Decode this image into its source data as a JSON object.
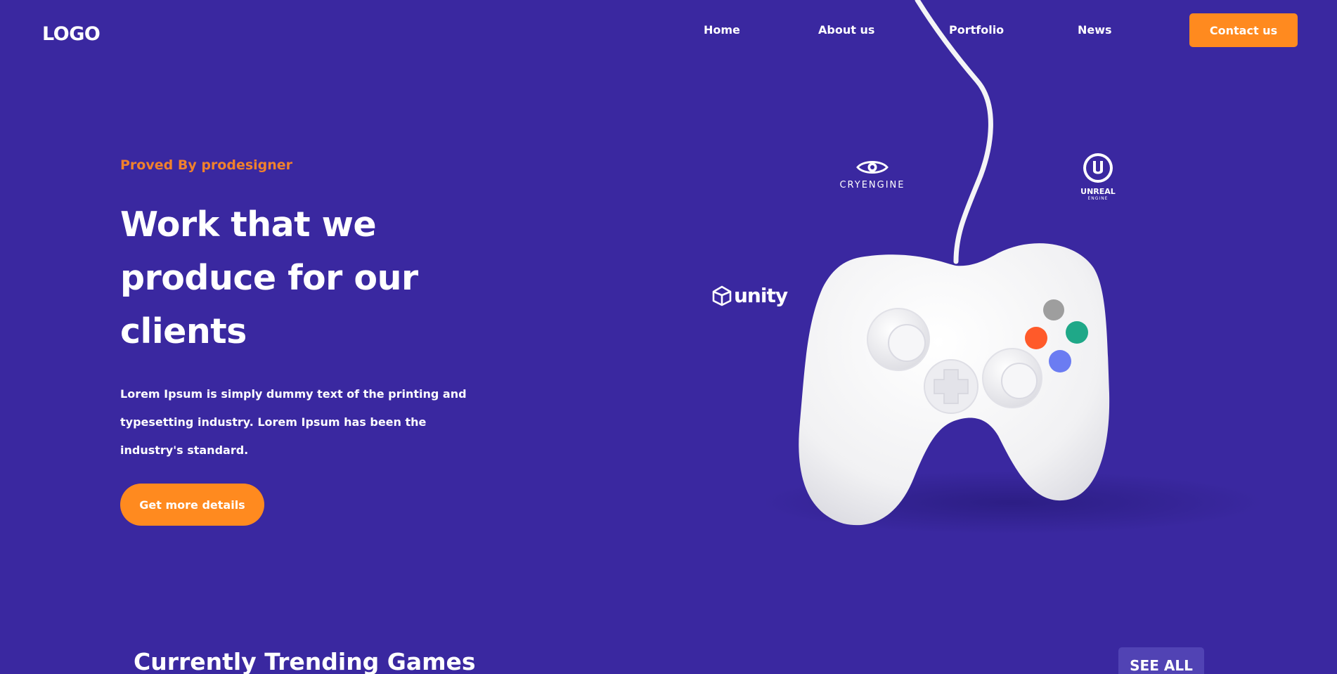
{
  "header": {
    "logo": "LOGO",
    "nav": [
      "Home",
      "About us",
      "Portfolio",
      "News"
    ],
    "contact_label": "Contact us"
  },
  "hero": {
    "eyebrow": "Proved By prodesigner",
    "headline_lines": [
      "Work that we",
      "produce for our",
      "clients"
    ],
    "lead": "Lorem Ipsum is simply dummy text of the printing and typesetting industry. Lorem Ipsum has been the industry's standard.",
    "cta_label": "Get more details"
  },
  "brands": {
    "cryengine": "CRYENGINE",
    "unreal": "UNREAL",
    "unreal_sub": "ENGINE",
    "unity": "unity"
  },
  "trending": {
    "title": "Currently Trending Games",
    "see_all": "SEE ALL"
  },
  "colors": {
    "background": "#3A28A0",
    "accent": "#FF8A1F",
    "eyebrow": "#F0812C",
    "button_a": "#9E9E9E",
    "button_b": "#1FA888",
    "button_x": "#FF5A2A",
    "button_y": "#6B7CF2"
  },
  "icons": [
    "cryengine-logo-icon",
    "unreal-logo-icon",
    "unity-logo-icon",
    "game-controller-image"
  ]
}
